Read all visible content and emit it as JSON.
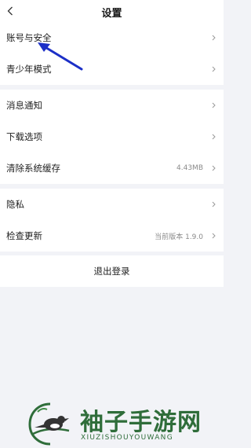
{
  "header": {
    "title": "设置",
    "back_icon": "chevron-left-icon"
  },
  "group1": [
    {
      "label": "账号与安全",
      "value": "",
      "icon": "chevron-right-icon"
    },
    {
      "label": "青少年模式",
      "value": "",
      "icon": "chevron-right-icon"
    }
  ],
  "group2": [
    {
      "label": "消息通知",
      "value": "",
      "icon": "chevron-right-icon"
    },
    {
      "label": "下载选项",
      "value": "",
      "icon": "chevron-right-icon"
    },
    {
      "label": "清除系统缓存",
      "value": "4.43MB",
      "icon": "chevron-right-icon"
    }
  ],
  "group3": [
    {
      "label": "隐私",
      "value": "",
      "icon": "chevron-right-icon"
    },
    {
      "label": "检查更新",
      "value": "当前版本 1.9.0",
      "icon": "chevron-right-icon"
    }
  ],
  "logout": {
    "label": "退出登录"
  },
  "annotation": {
    "icon": "blue-arrow-icon",
    "color": "#1c2fc7"
  },
  "watermark": {
    "title": "袖子手游网",
    "subtitle": "XIUZISHOUYOUWANG",
    "logo_icon": "bird-on-branch-logo",
    "color": "#2f6d3a"
  }
}
